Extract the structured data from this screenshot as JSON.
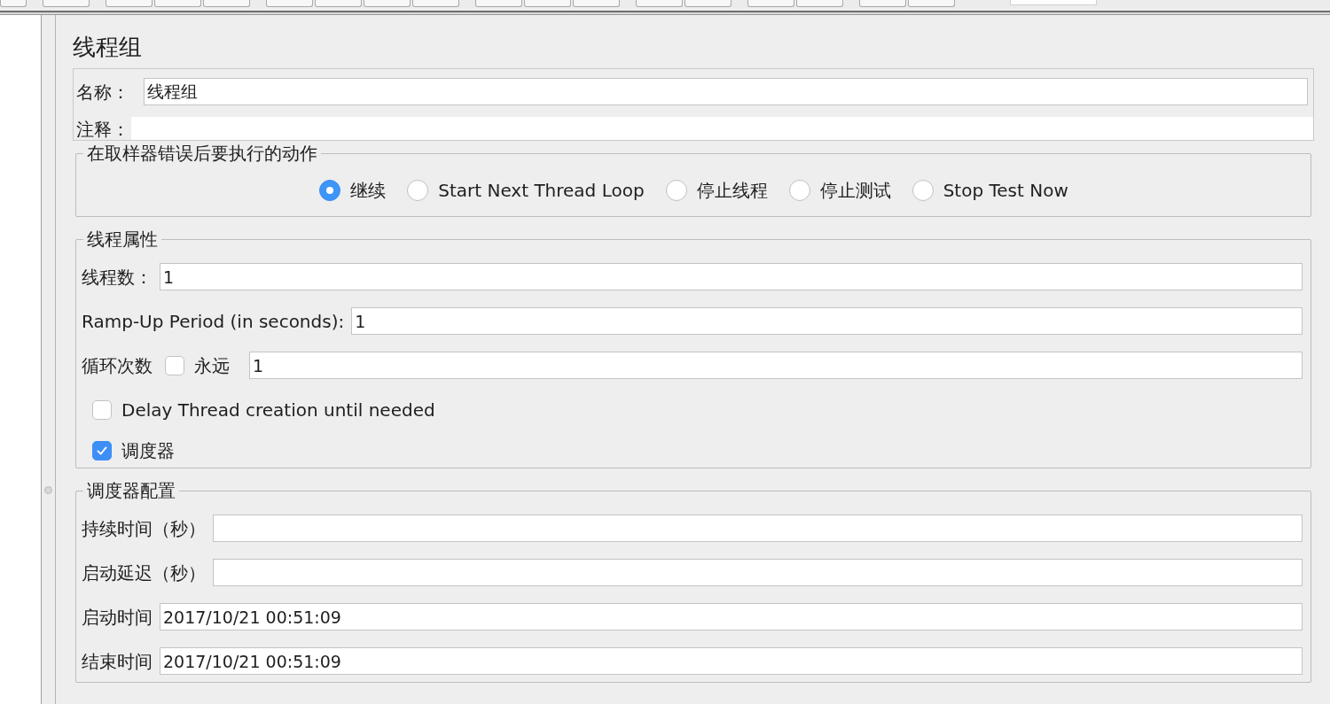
{
  "title": "线程组",
  "name_field": {
    "label": "名称：",
    "value": "线程组"
  },
  "comment_field": {
    "label": "注释："
  },
  "sampler_error_action": {
    "legend": "在取样器错误后要执行的动作",
    "options": [
      {
        "label": "继续",
        "selected": true
      },
      {
        "label": "Start Next Thread Loop",
        "selected": false
      },
      {
        "label": "停止线程",
        "selected": false
      },
      {
        "label": "停止测试",
        "selected": false
      },
      {
        "label": "Stop Test Now",
        "selected": false
      }
    ]
  },
  "thread_properties": {
    "legend": "线程属性",
    "rows": [
      {
        "kind": "field",
        "label": "线程数：",
        "value": "1"
      },
      {
        "kind": "field",
        "label": "Ramp-Up Period (in seconds):",
        "value": "1"
      },
      {
        "kind": "loop",
        "label": "循环次数",
        "forever": {
          "label": "永远",
          "checked": false
        },
        "value": "1"
      },
      {
        "kind": "checkbox",
        "label": "Delay Thread creation until needed",
        "checked": false
      },
      {
        "kind": "checkbox",
        "label": "调度器",
        "checked": true
      }
    ]
  },
  "scheduler_config": {
    "legend": "调度器配置",
    "rows": [
      {
        "kind": "field",
        "label": "持续时间（秒）"
      },
      {
        "kind": "field",
        "label": "启动延迟（秒）"
      },
      {
        "kind": "field",
        "label": "启动时间",
        "value": "2017/10/21 00:51:09"
      },
      {
        "kind": "field",
        "label": "结束时间",
        "value": "2017/10/21 00:51:09"
      }
    ]
  }
}
